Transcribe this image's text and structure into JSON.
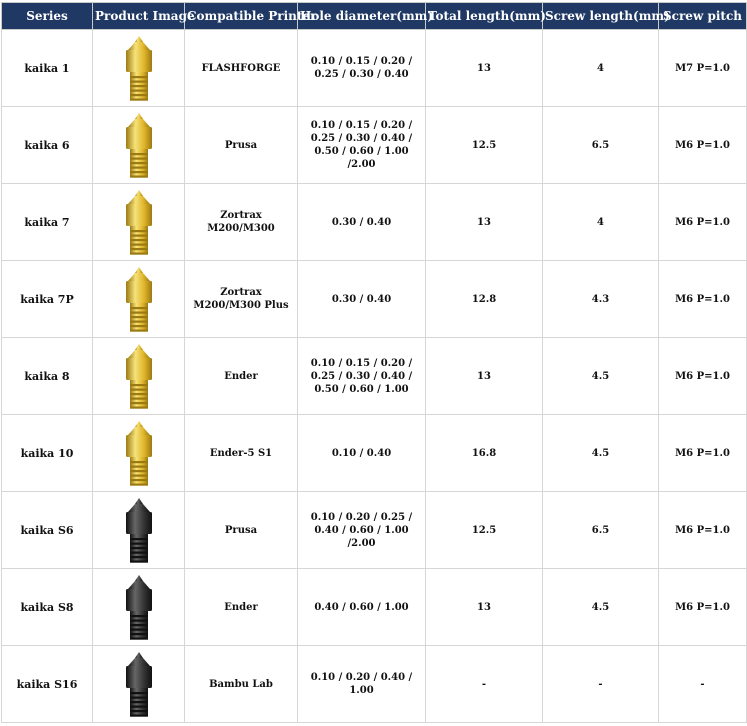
{
  "headers": [
    "Series",
    "Product Image",
    "Compatible Printer",
    "Hole diameter(mm)",
    "Total length(mm)",
    "Screw length(mm)",
    "Screw pitch"
  ],
  "colors": {
    "header_bg": "#1f3864",
    "brass": "#e0b52a",
    "black_nozzle": "#333333"
  },
  "rows": [
    {
      "series": "kaika 1",
      "image": "brass-nozzle-icon",
      "printer": "FLASHFORGE",
      "hole": "0.10 / 0.15 / 0.20 / 0.25 / 0.30 / 0.40",
      "total": "13",
      "screw": "4",
      "pitch": "M7 P=1.0"
    },
    {
      "series": "kaika 6",
      "image": "brass-nozzle-icon",
      "printer": "Prusa",
      "hole": "0.10 / 0.15 / 0.20 / 0.25 / 0.30 / 0.40 / 0.50 / 0.60 / 1.00 /2.00",
      "total": "12.5",
      "screw": "6.5",
      "pitch": "M6 P=1.0"
    },
    {
      "series": "kaika 7",
      "image": "brass-nozzle-icon",
      "printer": "Zortrax M200/M300",
      "hole": "0.30 / 0.40",
      "total": "13",
      "screw": "4",
      "pitch": "M6 P=1.0"
    },
    {
      "series": "kaika 7P",
      "image": "brass-nozzle-icon",
      "printer": "Zortrax M200/M300 Plus",
      "hole": "0.30 / 0.40",
      "total": "12.8",
      "screw": "4.3",
      "pitch": "M6 P=1.0"
    },
    {
      "series": "kaika 8",
      "image": "brass-nozzle-icon",
      "printer": "Ender",
      "hole": "0.10 / 0.15 / 0.20 / 0.25 / 0.30 / 0.40 / 0.50 / 0.60 / 1.00",
      "total": "13",
      "screw": "4.5",
      "pitch": "M6 P=1.0"
    },
    {
      "series": "kaika 10",
      "image": "brass-nozzle-icon",
      "printer": "Ender-5 S1",
      "hole": "0.10 / 0.40",
      "total": "16.8",
      "screw": "4.5",
      "pitch": "M6 P=1.0"
    },
    {
      "series": "kaika S6",
      "image": "black-nozzle-icon",
      "printer": "Prusa",
      "hole": "0.10 / 0.20 / 0.25 / 0.40 / 0.60 / 1.00 /2.00",
      "total": "12.5",
      "screw": "6.5",
      "pitch": "M6 P=1.0"
    },
    {
      "series": "kaika S8",
      "image": "black-nozzle-icon",
      "printer": "Ender",
      "hole": "0.40 / 0.60 / 1.00",
      "total": "13",
      "screw": "4.5",
      "pitch": "M6 P=1.0"
    },
    {
      "series": "kaika S16",
      "image": "black-nozzle-icon",
      "printer": "Bambu Lab",
      "hole": "0.10 / 0.20 / 0.40 / 1.00",
      "total": "-",
      "screw": "-",
      "pitch": "-"
    }
  ]
}
